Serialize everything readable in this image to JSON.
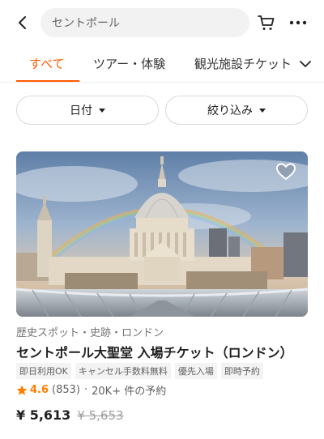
{
  "search": {
    "query": "セントポール"
  },
  "tabs": [
    {
      "label": "すべて",
      "active": true
    },
    {
      "label": "ツアー・体験",
      "active": false
    },
    {
      "label": "観光施設チケット",
      "active": false
    }
  ],
  "filters": {
    "date_label": "日付",
    "refine_label": "絞り込み"
  },
  "card": {
    "category": "歴史スポット・史跡・ロンドン",
    "title": "セントポール大聖堂 入場チケット（ロンドン）",
    "tags": [
      "即日利用OK",
      "キャンセル手数料無料",
      "優先入場",
      "即時予約"
    ],
    "rating": "4.6",
    "review_count": "(853)",
    "bookings": "20K+ 件の予約",
    "separator": "·",
    "price": "¥ 5,613",
    "original_price": "¥ 5,653",
    "image_subject": "st-pauls-cathedral-with-rainbow"
  },
  "colors": {
    "accent": "#ff5b00",
    "rating": "#ff8000",
    "text": "#212121",
    "muted": "#757575"
  },
  "icons": [
    "back-arrow-icon",
    "cart-icon",
    "more-icon",
    "chevron-down-icon",
    "heart-icon",
    "star-icon"
  ]
}
